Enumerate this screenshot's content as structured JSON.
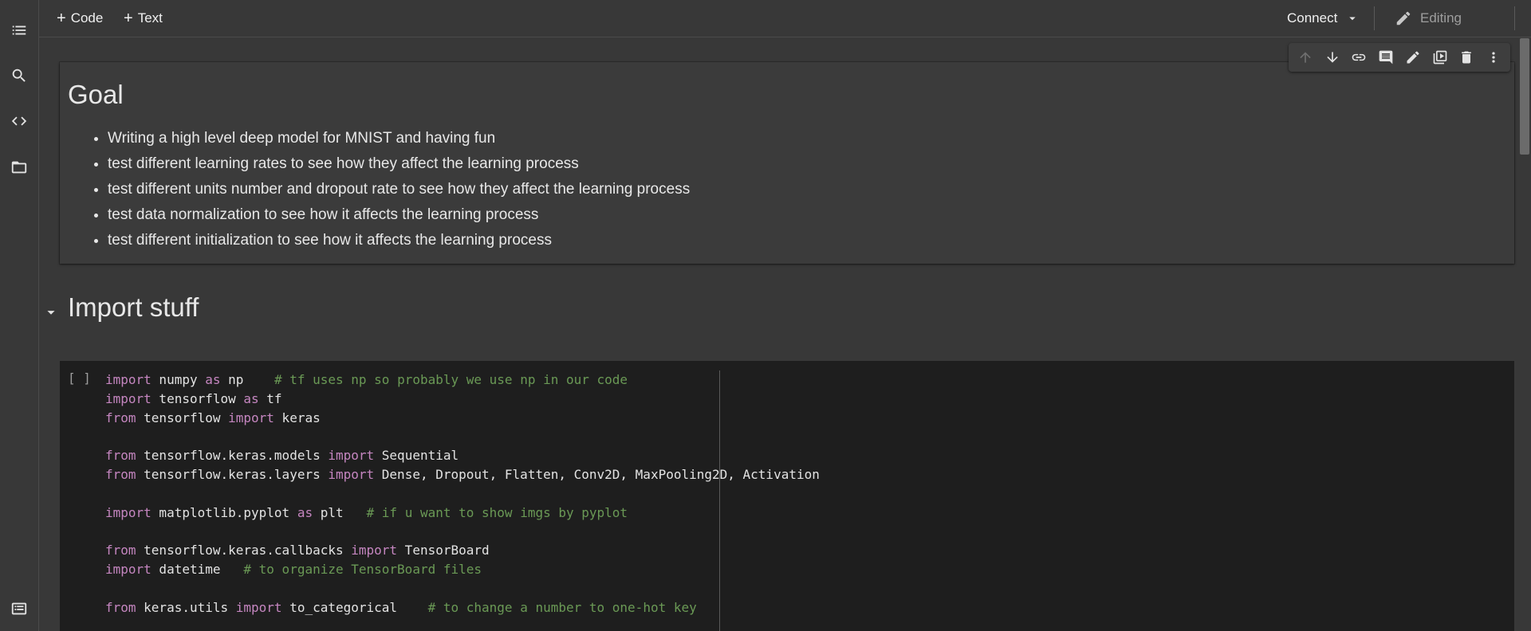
{
  "toolbar": {
    "add_code": "Code",
    "add_text": "Text",
    "connect": "Connect",
    "mode": "Editing"
  },
  "sidebar": {
    "items": [
      {
        "icon": "table-of-contents-icon"
      },
      {
        "icon": "search-icon"
      },
      {
        "icon": "code-snippets-icon"
      },
      {
        "icon": "folder-icon"
      },
      {
        "icon": "terminal-icon"
      }
    ]
  },
  "cell_toolbar": {
    "icons": [
      "move-up-icon",
      "move-down-icon",
      "link-icon",
      "comment-icon",
      "edit-icon",
      "mirror-cell-icon",
      "delete-icon",
      "more-icon"
    ]
  },
  "goal_cell": {
    "title": "Goal",
    "bullets": [
      "Writing a high level deep model for MNIST and having fun",
      "test different learning rates to see how they affect the learning process",
      "test different units number and dropout rate to see how they affect the learning process",
      "test data normalization to see how it affects the learning process",
      "test different initialization to see how it affects the learning process"
    ]
  },
  "section": {
    "title": "Import stuff"
  },
  "code_cell": {
    "run_indicator": "[ ]",
    "lines": [
      [
        [
          "kw",
          "import"
        ],
        [
          "t",
          " numpy "
        ],
        [
          "kw",
          "as"
        ],
        [
          "t",
          " np    "
        ],
        [
          "cm",
          "# tf uses np so probably we use np in our code"
        ]
      ],
      [
        [
          "kw",
          "import"
        ],
        [
          "t",
          " tensorflow "
        ],
        [
          "kw",
          "as"
        ],
        [
          "t",
          " tf"
        ]
      ],
      [
        [
          "kw",
          "from"
        ],
        [
          "t",
          " tensorflow "
        ],
        [
          "kw",
          "import"
        ],
        [
          "t",
          " keras"
        ]
      ],
      [],
      [
        [
          "kw",
          "from"
        ],
        [
          "t",
          " tensorflow.keras.models "
        ],
        [
          "kw",
          "import"
        ],
        [
          "t",
          " Sequential"
        ]
      ],
      [
        [
          "kw",
          "from"
        ],
        [
          "t",
          " tensorflow.keras.layers "
        ],
        [
          "kw",
          "import"
        ],
        [
          "t",
          " Dense, Dropout, Flatten, Conv2D, MaxPooling2D, Activation"
        ]
      ],
      [],
      [
        [
          "kw",
          "import"
        ],
        [
          "t",
          " matplotlib.pyplot "
        ],
        [
          "kw",
          "as"
        ],
        [
          "t",
          " plt   "
        ],
        [
          "cm",
          "# if u want to show imgs by pyplot"
        ]
      ],
      [],
      [
        [
          "kw",
          "from"
        ],
        [
          "t",
          " tensorflow.keras.callbacks "
        ],
        [
          "kw",
          "import"
        ],
        [
          "t",
          " TensorBoard"
        ]
      ],
      [
        [
          "kw",
          "import"
        ],
        [
          "t",
          " datetime   "
        ],
        [
          "cm",
          "# to organize TensorBoard files"
        ]
      ],
      [],
      [
        [
          "kw",
          "from"
        ],
        [
          "t",
          " keras.utils "
        ],
        [
          "kw",
          "import"
        ],
        [
          "t",
          " to_categorical    "
        ],
        [
          "cm",
          "# to change a number to one-hot key"
        ]
      ]
    ]
  },
  "colors": {
    "keyword": "#c586c0",
    "comment": "#6a9955",
    "code_bg": "#1e1e1e",
    "page_bg": "#383838"
  }
}
